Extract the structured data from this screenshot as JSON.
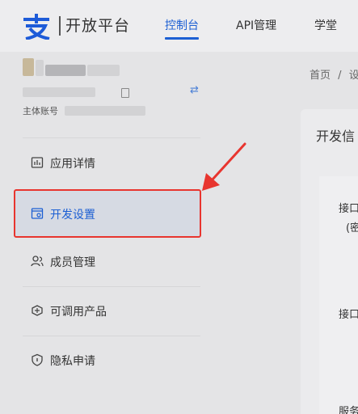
{
  "header": {
    "logo_text": "开放平台",
    "tabs": [
      {
        "label": "控制台",
        "active": true
      },
      {
        "label": "API管理",
        "active": false
      },
      {
        "label": "学堂",
        "active": false
      }
    ]
  },
  "sidebar": {
    "master_account_label": "主体账号",
    "menu": [
      {
        "label": "应用详情",
        "icon": "app-detail-icon"
      },
      {
        "label": "开发设置",
        "icon": "dev-settings-icon",
        "selected": true
      },
      {
        "label": "成员管理",
        "icon": "members-icon"
      },
      {
        "label": "可调用产品",
        "icon": "products-icon"
      },
      {
        "label": "隐私申请",
        "icon": "privacy-shield-icon"
      }
    ]
  },
  "main": {
    "breadcrumb": {
      "home": "首页",
      "separator": "/",
      "current": "设"
    },
    "card_title": "开发信",
    "fields": [
      "接口",
      "(密",
      "接口",
      "服务"
    ]
  },
  "colors": {
    "accent": "#1c5fd3",
    "highlight_border": "#e8352f",
    "arrow": "#e8352f"
  }
}
